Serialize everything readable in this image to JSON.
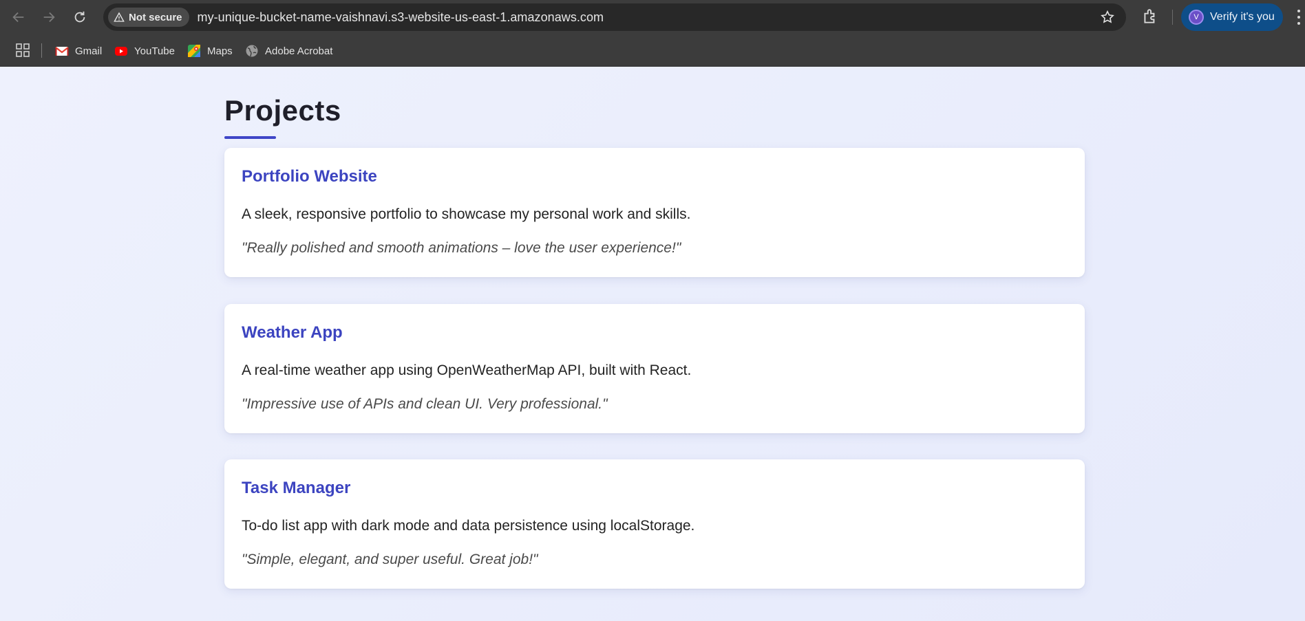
{
  "browser": {
    "security_chip": "Not secure",
    "url": "my-unique-bucket-name-vaishnavi.s3-website-us-east-1.amazonaws.com",
    "profile_label": "Verify it's you",
    "profile_initial": "V",
    "bookmarks": [
      {
        "label": "Gmail",
        "icon": "gmail-icon"
      },
      {
        "label": "YouTube",
        "icon": "youtube-icon"
      },
      {
        "label": "Maps",
        "icon": "maps-icon"
      },
      {
        "label": "Adobe Acrobat",
        "icon": "globe-icon"
      }
    ]
  },
  "page": {
    "heading": "Projects",
    "accent_color": "#3f46c7",
    "projects": [
      {
        "title": "Portfolio Website",
        "description": "A sleek, responsive portfolio to showcase my personal work and skills.",
        "quote": "\"Really polished and smooth animations – love the user experience!\""
      },
      {
        "title": "Weather App",
        "description": "A real-time weather app using OpenWeatherMap API, built with React.",
        "quote": "\"Impressive use of APIs and clean UI. Very professional.\""
      },
      {
        "title": "Task Manager",
        "description": "To-do list app with dark mode and data persistence using localStorage.",
        "quote": "\"Simple, elegant, and super useful. Great job!\""
      }
    ]
  }
}
